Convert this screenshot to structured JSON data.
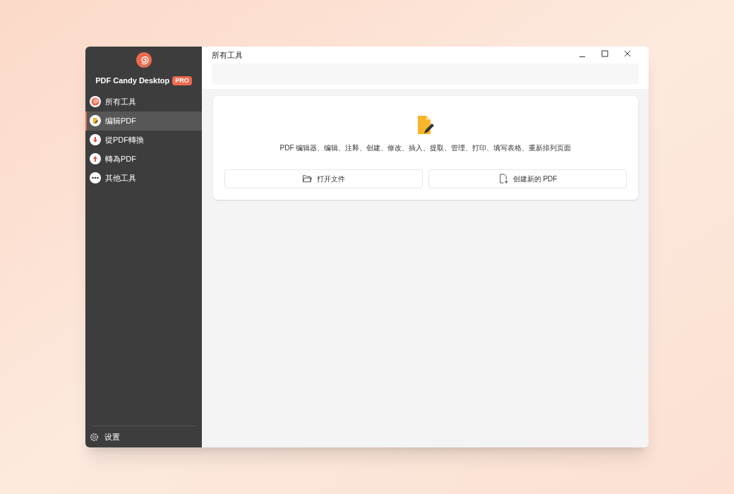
{
  "app": {
    "name": "PDF Candy Desktop",
    "badge": "PRO"
  },
  "sidebar": {
    "items": [
      {
        "label": "所有工具",
        "kind": "spiral",
        "selected": false
      },
      {
        "label": "编辑PDF",
        "kind": "edit",
        "selected": true
      },
      {
        "label": "從PDF轉換",
        "kind": "down",
        "selected": false
      },
      {
        "label": "轉為PDF",
        "kind": "up",
        "selected": false
      },
      {
        "label": "其他工具",
        "kind": "more",
        "selected": false
      }
    ],
    "settings": "设置"
  },
  "window": {
    "title": "所有工具"
  },
  "tool_card": {
    "description": "PDF 编辑器、编辑、注释、创建、修改、插入、提取、管理、打印、填写表格、重新排列页面",
    "buttons": [
      {
        "label": "打开文件",
        "kind": "open"
      },
      {
        "label": "创建新的 PDF",
        "kind": "new"
      }
    ]
  }
}
